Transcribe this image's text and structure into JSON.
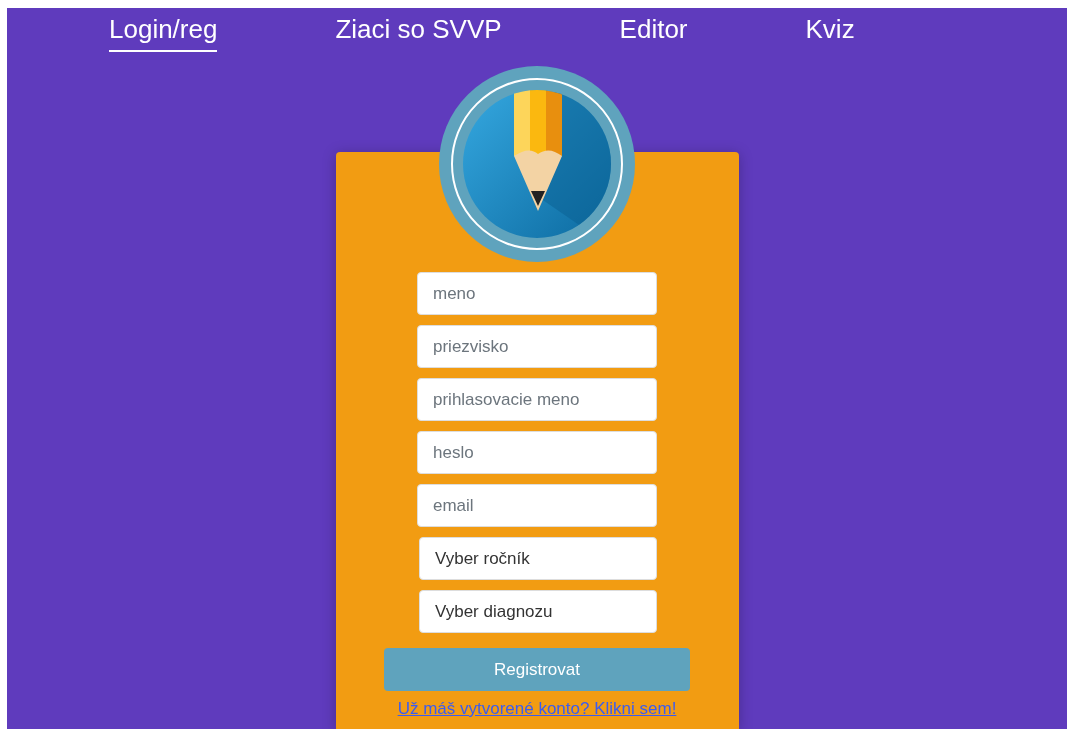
{
  "nav": [
    {
      "label": "Login/reg",
      "selected": true
    },
    {
      "label": "Ziaci so SVVP",
      "selected": false
    },
    {
      "label": "Editor",
      "selected": false
    },
    {
      "label": "Kviz",
      "selected": false
    }
  ],
  "form": {
    "fields": [
      {
        "kind": "input",
        "placeholder": "meno"
      },
      {
        "kind": "input",
        "placeholder": "priezvisko"
      },
      {
        "kind": "input",
        "placeholder": "prihlasovacie meno"
      },
      {
        "kind": "input",
        "placeholder": "heslo"
      },
      {
        "kind": "input",
        "placeholder": "email"
      },
      {
        "kind": "select",
        "value": "Vyber ročník"
      },
      {
        "kind": "select",
        "value": "Vyber diagnozu"
      }
    ],
    "submit": "Registrovat",
    "link": "Už máš vytvorené konto? Klikni sem!"
  }
}
